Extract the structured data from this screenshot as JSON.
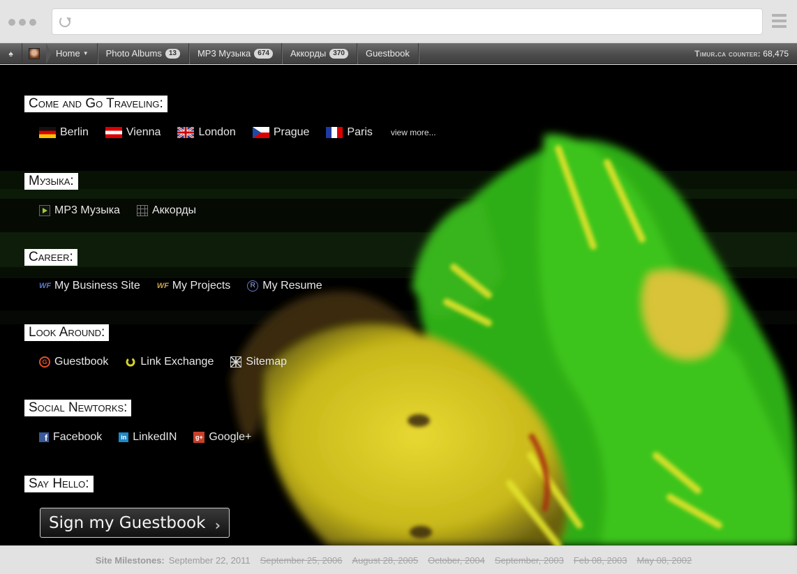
{
  "browser": {
    "url": ""
  },
  "nav": {
    "home": "Home",
    "items": [
      {
        "label": "Photo Albums",
        "badge": "13"
      },
      {
        "label": "MP3 Музыка",
        "badge": "674"
      },
      {
        "label": "Аккорды",
        "badge": "370"
      },
      {
        "label": "Guestbook",
        "badge": ""
      }
    ],
    "counter_label": "Timur.ca counter:",
    "counter_value": "68,475"
  },
  "sections": {
    "travel": {
      "title": "Come and Go Traveling:",
      "links": [
        "Berlin",
        "Vienna",
        "London",
        "Prague",
        "Paris"
      ],
      "more": "view more..."
    },
    "music": {
      "title": "Музыка:",
      "links": [
        "MP3 Музыка",
        "Аккорды"
      ]
    },
    "career": {
      "title": "Career:",
      "links": [
        "My Business Site",
        "My Projects",
        "My Resume"
      ]
    },
    "look": {
      "title": "Look Around:",
      "links": [
        "Guestbook",
        "Link Exchange",
        "Sitemap"
      ]
    },
    "social": {
      "title": "Social Newtorks:",
      "links": [
        "Facebook",
        "LinkedIN",
        "Google+"
      ]
    },
    "hello": {
      "title": "Say Hello:",
      "button": "Sign my Guestbook"
    }
  },
  "footer": {
    "label": "Site Milestones:",
    "current": "September 22, 2011",
    "past": [
      "September 25, 2006",
      "August 28, 2005",
      "October, 2004",
      "September, 2003",
      "Feb 08, 2003",
      "May 08, 2002"
    ]
  },
  "colors": {
    "accent_green": "#3fbf1f",
    "face_yellow": "#d8cc20",
    "nav_gray": "#4c4c4c"
  }
}
